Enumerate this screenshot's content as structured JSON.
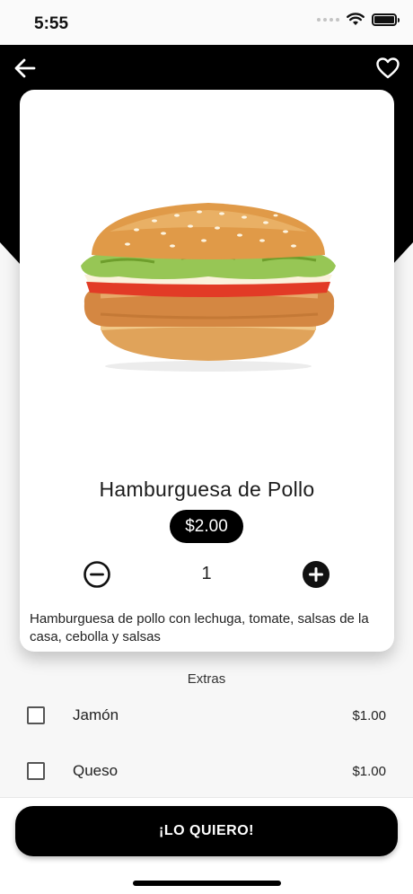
{
  "status_bar": {
    "time": "5:55"
  },
  "header": {
    "back_icon": "arrow-left-icon",
    "favorite_icon": "heart-outline-icon"
  },
  "product": {
    "image_icon": "chicken-burger-image",
    "name": "Hamburguesa de Pollo",
    "price": "$2.00",
    "quantity": "1",
    "description": "Hamburguesa de pollo con lechuga, tomate, salsas de la casa, cebolla y salsas"
  },
  "extras": {
    "title": "Extras",
    "items": [
      {
        "name": "Jamón",
        "price": "$1.00",
        "checked": false
      },
      {
        "name": "Queso",
        "price": "$1.00",
        "checked": false
      }
    ]
  },
  "cta": {
    "label": "¡LO QUIERO!"
  },
  "colors": {
    "primary": "#000000",
    "background": "#f7f7f7",
    "card": "#ffffff"
  }
}
